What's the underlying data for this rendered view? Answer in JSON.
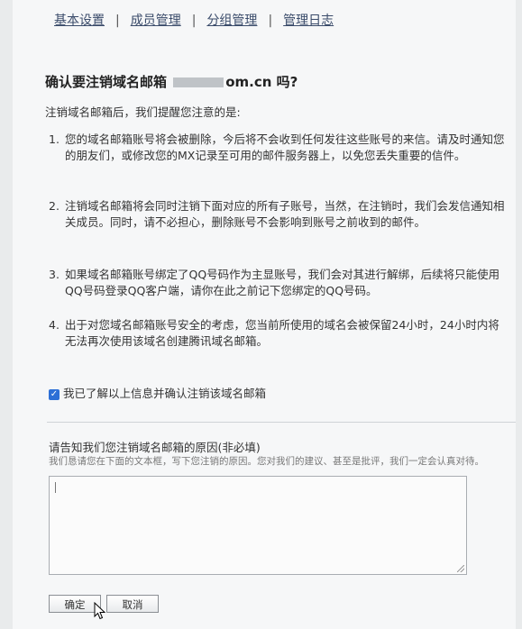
{
  "nav": {
    "items": [
      "基本设置",
      "成员管理",
      "分组管理",
      "管理日志"
    ]
  },
  "dialog": {
    "title_prefix": "确认要注销域名邮箱 ",
    "title_redacted": "",
    "title_suffix": "om.cn 吗?",
    "intro": "注销域名邮箱后，我们提醒您注意的是:",
    "items": [
      {
        "num": "1.",
        "text": "您的域名邮箱账号将会被删除，今后将不会收到任何发往这些账号的来信。请及时通知您的朋友们，或修改您的MX记录至可用的邮件服务器上，以免您丢失重要的信件。"
      },
      {
        "num": "2.",
        "text": "注销域名邮箱将会同时注销下面对应的所有子账号，当然，在注销时，我们会发信通知相关成员。同时，请不必担心，删除账号不会影响到账号之前收到的邮件。"
      },
      {
        "num": "3.",
        "text": "如果域名邮箱账号绑定了QQ号码作为主显账号，我们会对其进行解绑，后续将只能使用QQ号码登录QQ客户端，请你在此之前记下您绑定的QQ号码。"
      },
      {
        "num": "4.",
        "text": "出于对您域名邮箱账号安全的考虑，您当前所使用的域名会被保留24小时，24小时内将无法再次使用该域名创建腾讯域名邮箱。"
      }
    ],
    "confirm_label": "我已了解以上信息并确认注销该域名邮箱",
    "confirm_checked": true,
    "reason_title": "请告知我们您注销域名邮箱的原因(非必填)",
    "reason_hint": "我们恳请您在下面的文本框，写下您注销的原因。您对我们的建议、甚至是批评，我们一定会认真对待。",
    "reason_value": "",
    "ok_label": "确定",
    "cancel_label": "取消"
  },
  "colors": {
    "accent": "#2d6fd6",
    "nav_link": "#3a4b6a",
    "background": "#f6f7f8"
  },
  "icons": {
    "checkbox": "check-icon",
    "cursor": "mouse-pointer-icon"
  }
}
